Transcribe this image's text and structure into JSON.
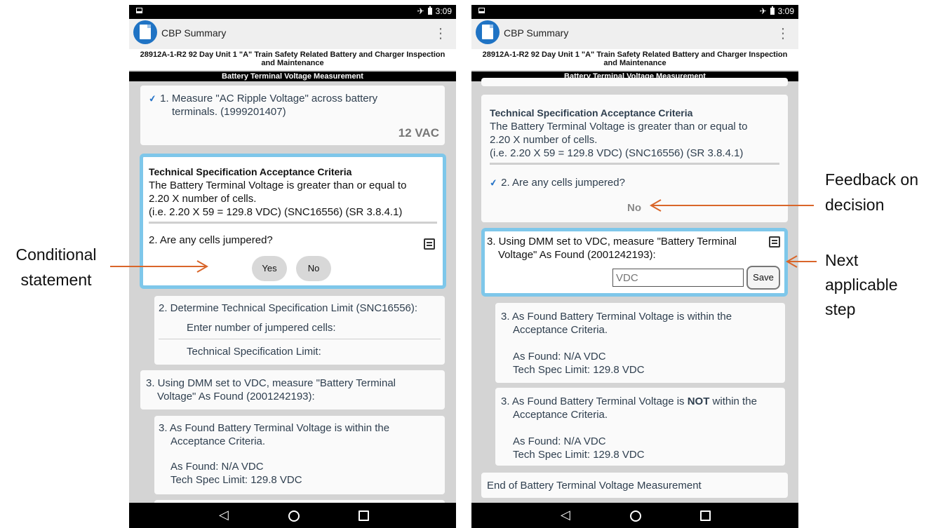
{
  "status": {
    "time": "3:09",
    "airplane": "✈"
  },
  "app": {
    "title": "CBP Summary",
    "menu_icon": "⋮"
  },
  "doc": {
    "title_line1": "28912A-1-R2 92 Day Unit 1 \"A\" Train Safety Related Battery and Charger Inspection",
    "title_line2": "and Maintenance",
    "section": "Battery Terminal Voltage Measurement"
  },
  "left": {
    "step1": {
      "line1": "1. Measure \"AC Ripple Voltage\" across battery",
      "line2": "terminals. (1999201407)",
      "value": "12 VAC"
    },
    "criteria": {
      "title": "Technical Specification Acceptance Criteria",
      "line1": "The Battery Terminal Voltage is greater than or equal to",
      "line2": "2.20 X number of cells.",
      "line3": "(i.e. 2.20 X 59 = 129.8 VDC) (SNC16556) (SR 3.8.4.1)",
      "question": "2. Are any cells jumpered?",
      "yes": "Yes",
      "no": "No"
    },
    "limit": {
      "title": "2. Determine Technical Specification Limit (SNC16556):",
      "row1": "Enter number of jumpered cells:",
      "row2": "Technical Specification Limit:"
    },
    "measure": {
      "line1": "3. Using DMM set to VDC, measure \"Battery Terminal",
      "line2": "Voltage\" As Found (2001242193):"
    },
    "within": {
      "line1": "3. As Found Battery Terminal Voltage is within the",
      "line2": "Acceptance Criteria.",
      "found": "As Found: N/A VDC",
      "limit": "Tech Spec Limit: 129.8 VDC"
    }
  },
  "right": {
    "criteria": {
      "title": "Technical Specification Acceptance Criteria",
      "line1": "The Battery Terminal Voltage is greater than or equal to",
      "line2": "2.20 X number of cells.",
      "line3": "(i.e. 2.20 X 59 = 129.8 VDC) (SNC16556) (SR 3.8.4.1)",
      "question": "2. Are any cells jumpered?",
      "answer": "No"
    },
    "measure": {
      "line1": "3. Using DMM set to VDC, measure \"Battery Terminal",
      "line2": "Voltage\" As Found (2001242193):",
      "placeholder": "VDC",
      "save": "Save"
    },
    "within": {
      "line1": "3. As Found Battery Terminal Voltage is within the",
      "line2": "Acceptance Criteria.",
      "found": "As Found: N/A VDC",
      "limit": "Tech Spec Limit: 129.8 VDC"
    },
    "not_within": {
      "pre": "3. As Found Battery Terminal Voltage is ",
      "bold": "NOT",
      "post": " within the",
      "line2": "Acceptance Criteria.",
      "found": "As Found: N/A VDC",
      "limit": "Tech Spec Limit: 129.8 VDC"
    },
    "end": "End of Battery Terminal Voltage Measurement"
  },
  "annotations": {
    "conditional_1": "Conditional",
    "conditional_2": "statement",
    "feedback_1": "Feedback on",
    "feedback_2": "decision",
    "next_1": "Next",
    "next_2": "applicable",
    "next_3": "step"
  },
  "colors": {
    "arrow": "#d9662a",
    "highlight": "#7ec7ea"
  }
}
